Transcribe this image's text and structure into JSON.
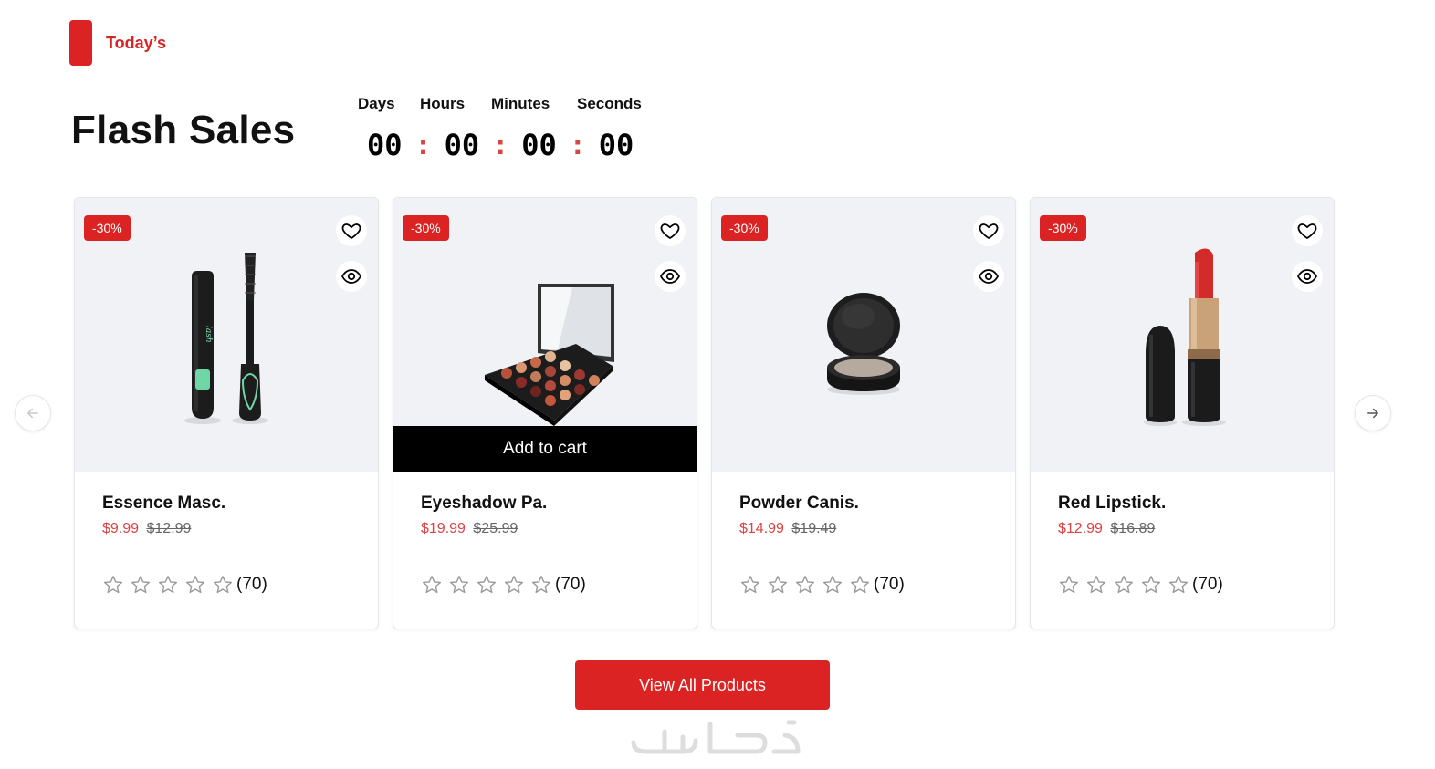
{
  "section": {
    "tag": "Today’s",
    "title": "Flash Sales"
  },
  "countdown": {
    "labels": {
      "days": "Days",
      "hours": "Hours",
      "minutes": "Minutes",
      "seconds": "Seconds"
    },
    "values": {
      "days": "00",
      "hours": "00",
      "minutes": "00",
      "seconds": "00"
    },
    "separator": ":"
  },
  "products": [
    {
      "name": "Essence Masc.",
      "price": "$9.99",
      "old_price": "$12.99",
      "discount": "-30%",
      "reviews": "(70)",
      "rating": 0,
      "image": "mascara"
    },
    {
      "name": "Eyeshadow Pa.",
      "price": "$19.99",
      "old_price": "$25.99",
      "discount": "-30%",
      "reviews": "(70)",
      "rating": 0,
      "image": "eyeshadow-palette",
      "hover_action": "Add to cart"
    },
    {
      "name": "Powder Canis.",
      "price": "$14.99",
      "old_price": "$19.49",
      "discount": "-30%",
      "reviews": "(70)",
      "rating": 0,
      "image": "powder-compact"
    },
    {
      "name": "Red Lipstick.",
      "price": "$12.99",
      "old_price": "$16.89",
      "discount": "-30%",
      "reviews": "(70)",
      "rating": 0,
      "image": "red-lipstick"
    }
  ],
  "actions": {
    "view_all": "View All Products"
  },
  "icons": {
    "wishlist": "heart-icon",
    "quick_view": "eye-icon",
    "prev": "arrow-left-icon",
    "next": "arrow-right-icon",
    "star": "star-outline-icon"
  },
  "colors": {
    "accent": "#DB2323",
    "price": "#DB4444",
    "media_bg": "#F0F2F5"
  }
}
